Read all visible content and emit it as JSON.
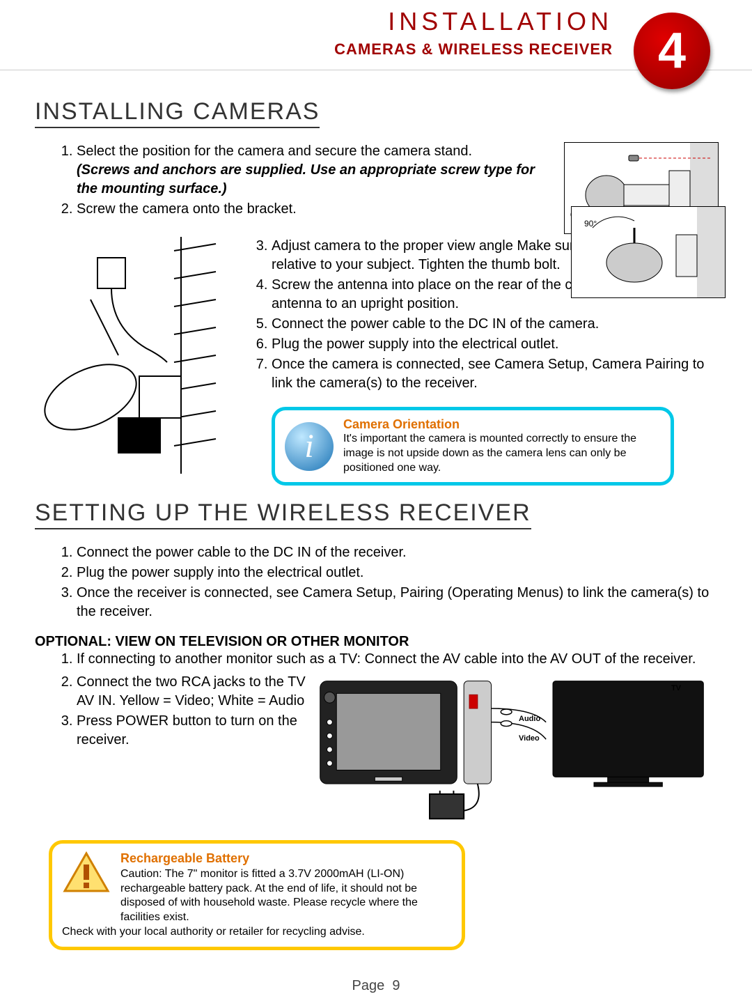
{
  "header": {
    "title": "INSTALLATION",
    "subtitle": "CAMERAS & WIRELESS RECEIVER",
    "number": "4"
  },
  "section1": {
    "heading": "INSTALLING CAMERAS",
    "steps_a": [
      "Select the position for the camera and secure the camera stand.",
      "Screw the camera onto the bracket."
    ],
    "note_a": "(Screws and anchors are supplied. Use an appropriate screw type for the mounting surface.)",
    "steps_b": [
      "Adjust camera to the proper view angle Make sure the lens is upright relative to your subject. Tighten the thumb bolt.",
      "Screw the antenna into place on the rear of the camera. Adjust the antenna to an upright position.",
      "Connect the power cable to the DC IN of the camera.",
      "Plug the power supply into the electrical outlet.",
      "Once the camera is connected, see Camera Setup, Camera Pairing to link the camera(s) to the receiver."
    ],
    "angle_label": "90°"
  },
  "callout1": {
    "title": "Camera Orientation",
    "body": "It's important the camera is mounted correctly to ensure the image is not upside down as the camera lens can only be positioned one way."
  },
  "section2": {
    "heading": "SETTING UP THE WIRELESS RECEIVER",
    "steps": [
      "Connect the power cable to the DC IN of the receiver.",
      "Plug the power supply into the electrical outlet.",
      "Once the receiver is connected, see Camera Setup, Pairing (Operating Menus) to link the camera(s) to the receiver."
    ],
    "optional_heading": "OPTIONAL: VIEW ON TELEVISION OR OTHER MONITOR",
    "optional_steps": [
      "If connecting to another monitor such as a TV: Connect the AV cable into the AV OUT of the receiver.",
      "Connect the two RCA jacks to the TV AV IN.  Yellow = Video; White = Audio",
      "Press POWER button to turn on the receiver."
    ],
    "tv_labels": {
      "tv": "TV",
      "audio": "Audio",
      "video": "Video"
    }
  },
  "callout2": {
    "title": "Rechargeable Battery",
    "body": "Caution: The 7\" monitor is fitted a 3.7V 2000mAH (LI-ON) rechargeable battery pack. At the end of life, it should not be disposed of with household waste. Please recycle where the facilities exist.",
    "footer": "Check with your local authority or retailer for recycling advise."
  },
  "footer": {
    "label": "Page",
    "num": "9"
  }
}
